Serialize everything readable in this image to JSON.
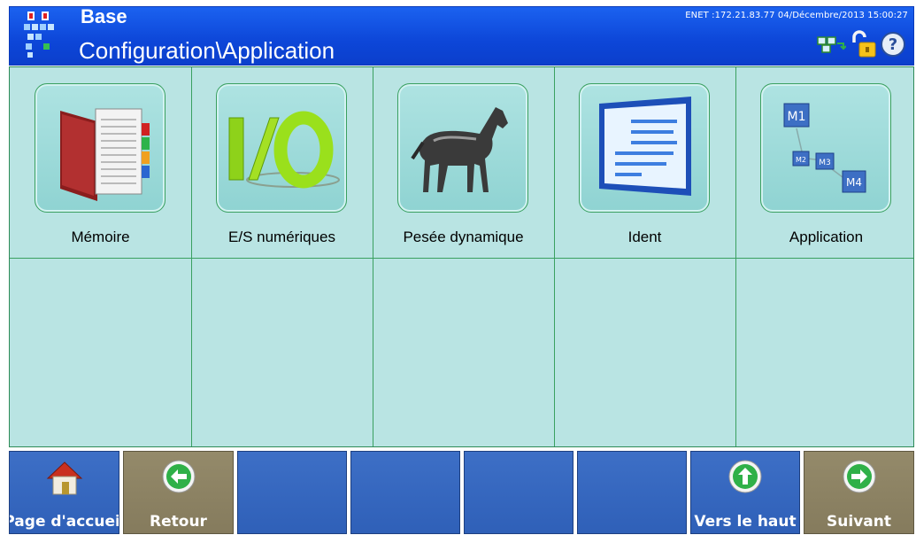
{
  "header": {
    "title": "Base",
    "path": "Configuration\\Application",
    "status": "ENET :172.21.83.77  04/Décembre/2013 15:00:27",
    "icons": [
      "network-icon",
      "unlocked-padlock-icon",
      "help-icon"
    ]
  },
  "tiles": [
    {
      "label": "Mémoire",
      "icon": "memory-book-icon"
    },
    {
      "label": "E/S numériques",
      "icon": "io-icon"
    },
    {
      "label": "Pesée dynamique",
      "icon": "horse-icon"
    },
    {
      "label": "Ident",
      "icon": "ident-screen-icon"
    },
    {
      "label": "Application",
      "icon": "application-m1-m4-icon"
    }
  ],
  "softkeys": [
    {
      "label": "Page d'accueil",
      "icon": "home-icon"
    },
    {
      "label": "Retour",
      "icon": "back-arrow-icon"
    },
    {
      "label": ""
    },
    {
      "label": ""
    },
    {
      "label": ""
    },
    {
      "label": ""
    },
    {
      "label": "Vers le haut",
      "icon": "up-arrow-icon"
    },
    {
      "label": "Suivant",
      "icon": "next-arrow-icon"
    }
  ],
  "colors": {
    "titlebar": "#1150e4",
    "grid_bg": "#b9e4e3",
    "grid_line": "#3aa060",
    "softkey_blue": "#3466bd",
    "softkey_tan": "#8c8263"
  }
}
